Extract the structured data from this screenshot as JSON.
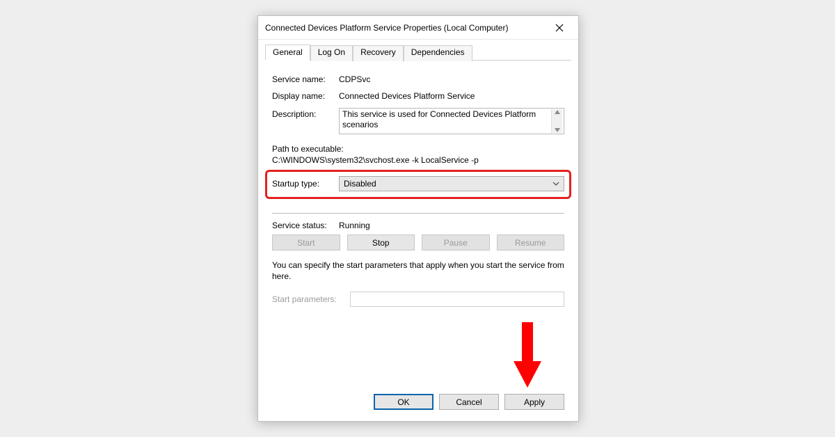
{
  "window": {
    "title": "Connected Devices Platform Service Properties (Local Computer)"
  },
  "tabs": [
    "General",
    "Log On",
    "Recovery",
    "Dependencies"
  ],
  "general": {
    "serviceNameLabel": "Service name:",
    "serviceName": "CDPSvc",
    "displayNameLabel": "Display name:",
    "displayName": "Connected Devices Platform Service",
    "descriptionLabel": "Description:",
    "description": "This service is used for Connected Devices Platform scenarios",
    "pathLabel": "Path to executable:",
    "pathValue": "C:\\WINDOWS\\system32\\svchost.exe -k LocalService -p",
    "startupTypeLabel": "Startup type:",
    "startupTypeValue": "Disabled",
    "serviceStatusLabel": "Service status:",
    "serviceStatusValue": "Running",
    "buttons": {
      "start": "Start",
      "stop": "Stop",
      "pause": "Pause",
      "resume": "Resume"
    },
    "hint": "You can specify the start parameters that apply when you start the service from here.",
    "startParamsLabel": "Start parameters:",
    "startParamsValue": ""
  },
  "footer": {
    "ok": "OK",
    "cancel": "Cancel",
    "apply": "Apply"
  }
}
